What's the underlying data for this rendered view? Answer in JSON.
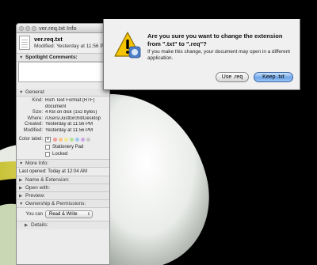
{
  "info_window": {
    "title": "ver.req.txt Info",
    "file_name": "ver.req.txt",
    "modified_header": "Modified: Yesterday at 11:56 PM",
    "sections": {
      "spotlight": "Spotlight Comments:",
      "general": "General:",
      "more_info": "More Info:",
      "name_ext": "Name & Extension:",
      "open_with": "Open with:",
      "preview": "Preview:",
      "ownership": "Ownership & Permissions:",
      "details": "Details:"
    },
    "general": {
      "kind_label": "Kind:",
      "kind": "Rich Text Format (RTF)",
      "kind2": "document",
      "size_label": "Size:",
      "size": "4 KB on disk (152 bytes)",
      "where_label": "Where:",
      "where": "/Users/Justtorchit/Desktop",
      "created_label": "Created:",
      "created": "Yesterday at 11:56 PM",
      "modified_label": "Modified:",
      "modified": "Yesterday at 11:56 PM",
      "color_label": "Color label:",
      "label_none": "x",
      "label_colors": [
        "#f29b9b",
        "#f6c58c",
        "#f3ea8c",
        "#b6e29a",
        "#9fc7ee",
        "#cda7e6",
        "#c6c6c6"
      ],
      "stationery": "Stationery Pad",
      "locked": "Locked"
    },
    "more_info": {
      "last_opened": "Last opened: Today at 12:04 AM"
    },
    "ownership": {
      "you_can_label": "You can",
      "permission": "Read & Write"
    }
  },
  "alert": {
    "title": "Are you sure you want to change the extension from \".txt\" to \".req\"?",
    "message": "If you make this change, your document may open in a different application.",
    "use_button": "Use .req",
    "keep_button": "Keep .txt"
  },
  "colors": {
    "accent": "#6fa6e8",
    "warning": "#f5c400"
  }
}
